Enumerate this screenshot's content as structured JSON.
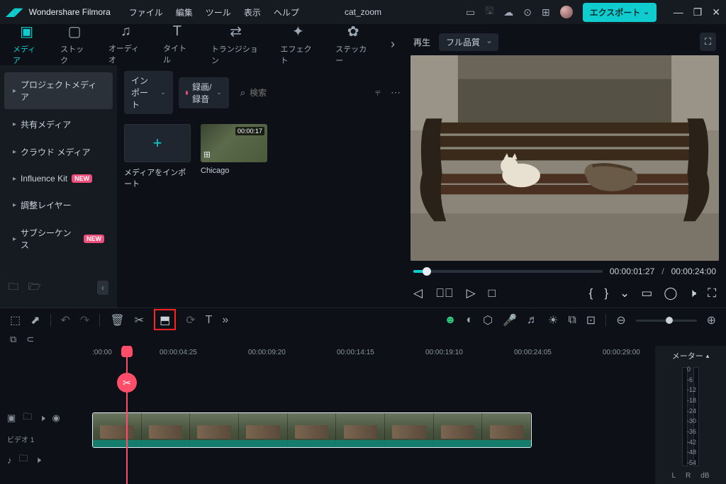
{
  "app_name": "Wondershare Filmora",
  "project": "cat_zoom",
  "menus": [
    "ファイル",
    "編集",
    "ツール",
    "表示",
    "ヘルプ"
  ],
  "export_label": "エクスポート",
  "tabs": [
    {
      "label": "メディア"
    },
    {
      "label": "ストック"
    },
    {
      "label": "オーディオ"
    },
    {
      "label": "タイトル"
    },
    {
      "label": "トランジション"
    },
    {
      "label": "エフェクト"
    },
    {
      "label": "ステッカー"
    }
  ],
  "sidebar": {
    "items": [
      {
        "label": "プロジェクトメディア",
        "active": true
      },
      {
        "label": "共有メディア"
      },
      {
        "label": "クラウド メディア"
      },
      {
        "label": "Influence Kit",
        "badge": "NEW"
      },
      {
        "label": "調整レイヤー"
      },
      {
        "label": "サブシーケンス",
        "badge": "NEW"
      }
    ]
  },
  "content_toolbar": {
    "import": "インポート",
    "record": "録画/録音",
    "search_placeholder": "検索"
  },
  "media": {
    "import_label": "メディアをインポート",
    "clip": {
      "duration": "00:00:17",
      "name": "Chicago"
    }
  },
  "preview": {
    "play_label": "再生",
    "quality": "フル品質",
    "current": "00:00:01:27",
    "sep": "/",
    "total": "00:00:24:00"
  },
  "timeline": {
    "ticks": [
      ":00:00",
      "00:00:04:25",
      "00:00:09:20",
      "00:00:14:15",
      "00:00:19:10",
      "00:00:24:05",
      "00:00:29:00"
    ],
    "video_track": "ビデオ 1",
    "meter": {
      "title": "メーター",
      "scale": [
        "0",
        "-6",
        "-12",
        "-18",
        "-24",
        "-30",
        "-36",
        "-42",
        "-48",
        "-54"
      ],
      "L": "L",
      "R": "R",
      "db": "dB"
    }
  }
}
